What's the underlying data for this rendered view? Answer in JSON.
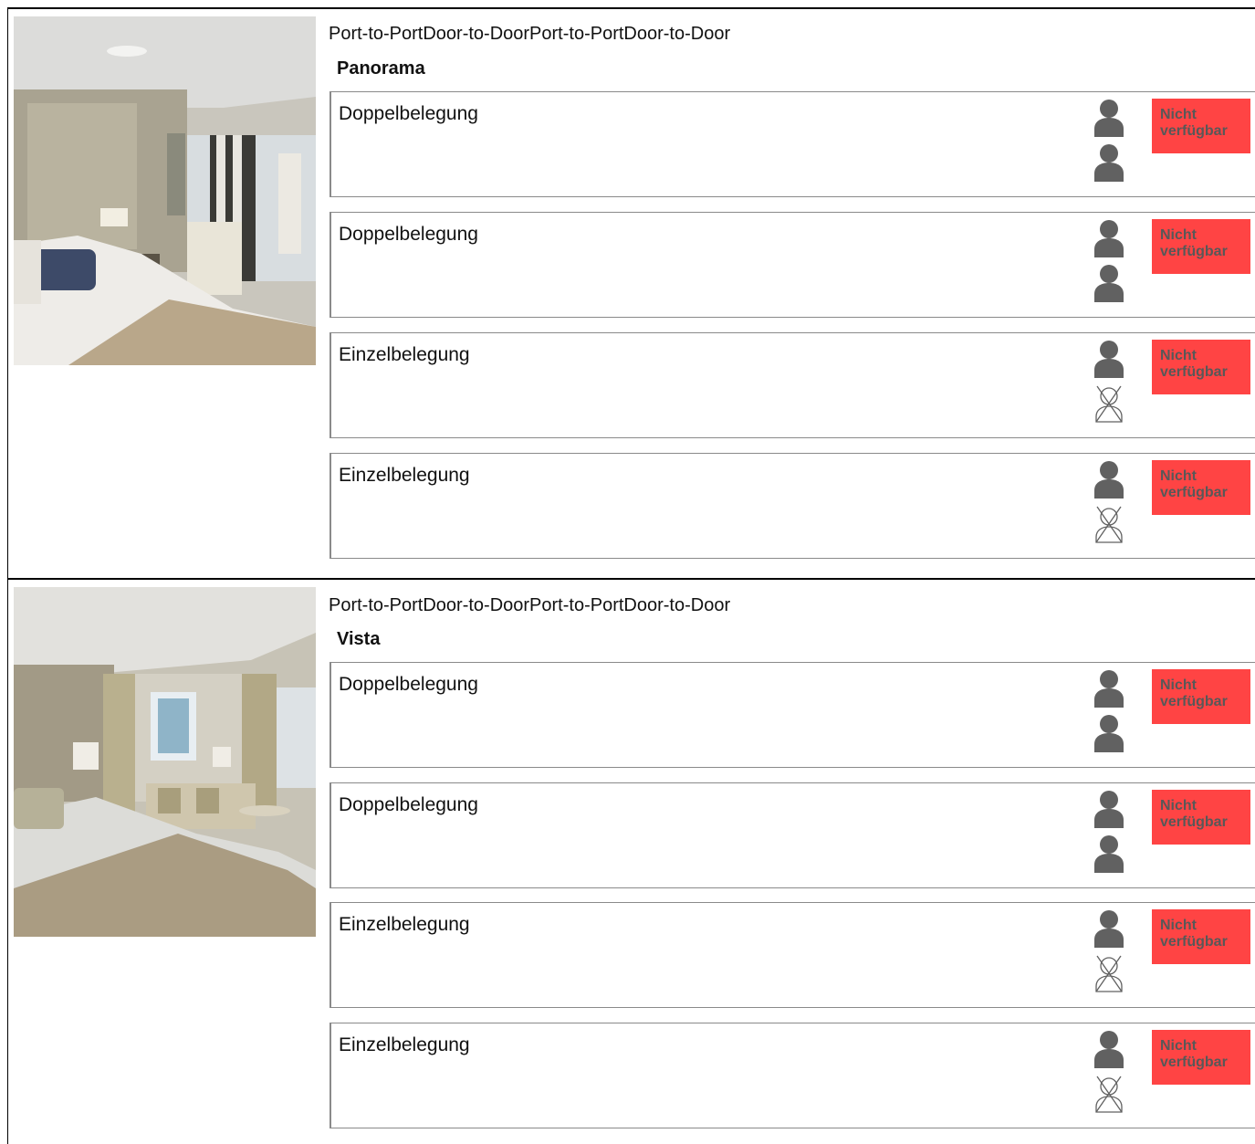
{
  "suites": [
    {
      "image_alt": "Panorama suite bedroom photo",
      "tariff": "Port-to-PortDoor-to-DoorPort-to-PortDoor-to-Door",
      "name": "Panorama",
      "occupancies": [
        {
          "label": "Doppelbelegung",
          "persons": 2,
          "status": "Nicht verfügbar"
        },
        {
          "label": "Doppelbelegung",
          "persons": 2,
          "status": "Nicht verfügbar"
        },
        {
          "label": "Einzelbelegung",
          "persons": 1,
          "status": "Nicht verfügbar"
        },
        {
          "label": "Einzelbelegung",
          "persons": 1,
          "status": "Nicht verfügbar"
        }
      ]
    },
    {
      "image_alt": "Vista suite bedroom photo",
      "tariff": "Port-to-PortDoor-to-DoorPort-to-PortDoor-to-Door",
      "name": "Vista",
      "occupancies": [
        {
          "label": "Doppelbelegung",
          "persons": 2,
          "status": "Nicht verfügbar"
        },
        {
          "label": "Doppelbelegung",
          "persons": 2,
          "status": "Nicht verfügbar"
        },
        {
          "label": "Einzelbelegung",
          "persons": 1,
          "status": "Nicht verfügbar"
        },
        {
          "label": "Einzelbelegung",
          "persons": 1,
          "status": "Nicht verfügbar"
        }
      ]
    }
  ],
  "icons": {
    "guest": "person-icon",
    "no_guest": "person-crossed-icon"
  },
  "colors": {
    "status_bg": "#ff4444",
    "status_text": "#585858",
    "icon": "#616161",
    "box_border": "#8a8a8a"
  }
}
